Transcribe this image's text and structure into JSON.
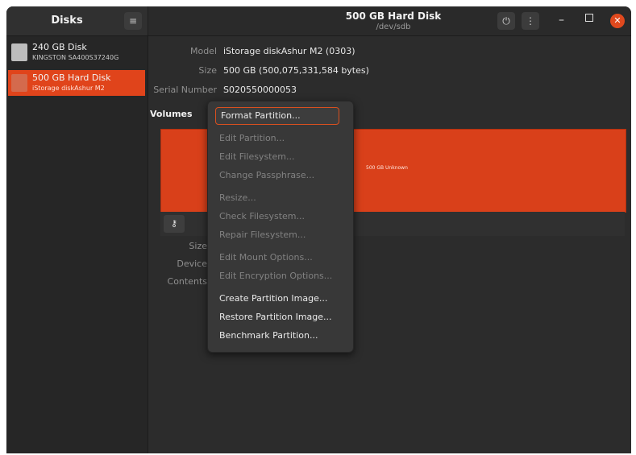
{
  "sidebar_title": "Disks",
  "window": {
    "title": "500 GB Hard Disk",
    "subtitle": "/dev/sdb"
  },
  "disks": [
    {
      "name": "240 GB Disk",
      "model": "KINGSTON SA400S37240G",
      "selected": false
    },
    {
      "name": "500 GB Hard Disk",
      "model": "iStorage diskAshur M2",
      "selected": true
    }
  ],
  "properties": {
    "model_label": "Model",
    "model_value": "iStorage diskAshur M2 (0303)",
    "size_label": "Size",
    "size_value": "500 GB (500,075,331,584 bytes)",
    "serial_label": "Serial Number",
    "serial_value": "S020550000053"
  },
  "volumes": {
    "label": "Volumes",
    "bar_text": "500 GB Unknown"
  },
  "lower_props": {
    "size_label": "Size",
    "device_label": "Device",
    "contents_label": "Contents",
    "paren_text": ")"
  },
  "context_menu": {
    "items": [
      {
        "label": "Format Partition...",
        "state": "highlight"
      },
      {
        "label": "Edit Partition...",
        "state": "disabled"
      },
      {
        "label": "Edit Filesystem...",
        "state": "disabled"
      },
      {
        "label": "Change Passphrase...",
        "state": "disabled"
      },
      {
        "label": "Resize...",
        "state": "disabled"
      },
      {
        "label": "Check Filesystem...",
        "state": "disabled"
      },
      {
        "label": "Repair Filesystem...",
        "state": "disabled"
      },
      {
        "label": "Edit Mount Options...",
        "state": "disabled"
      },
      {
        "label": "Edit Encryption Options...",
        "state": "disabled"
      },
      {
        "label": "Create Partition Image...",
        "state": "enabled"
      },
      {
        "label": "Restore Partition Image...",
        "state": "enabled"
      },
      {
        "label": "Benchmark Partition...",
        "state": "enabled"
      }
    ]
  },
  "colors": {
    "accent": "#e0441b",
    "close": "#e0491e",
    "background": "#2c2c2c"
  }
}
